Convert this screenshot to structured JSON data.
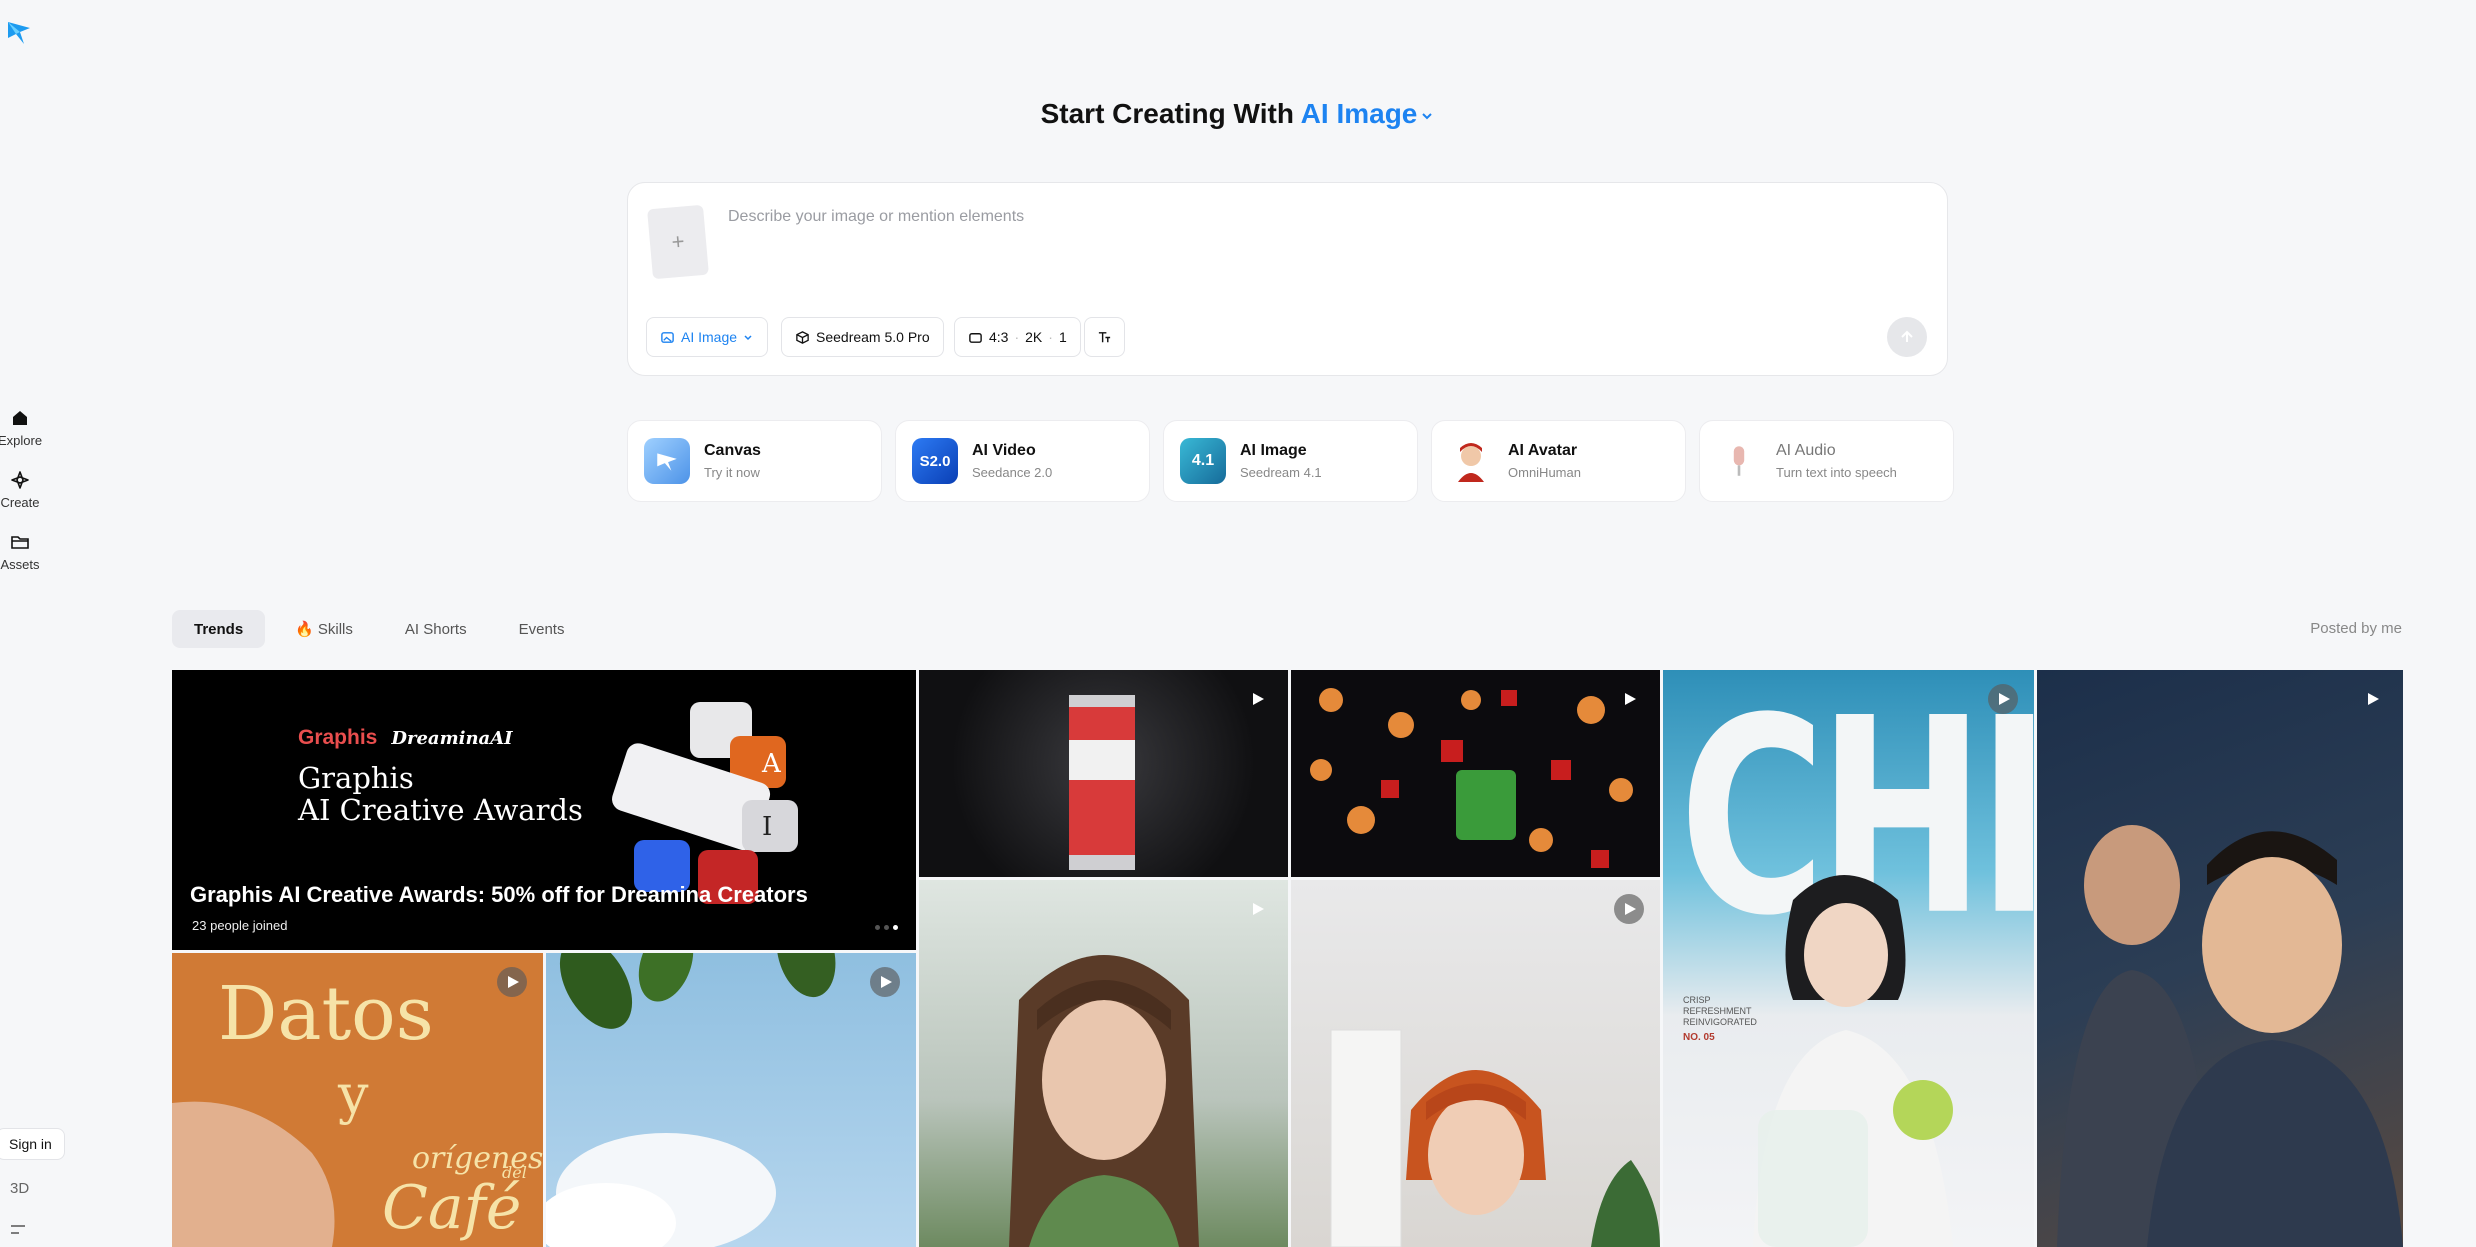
{
  "sidebar": {
    "items": [
      {
        "label": "Explore",
        "icon": "home-icon"
      },
      {
        "label": "Create",
        "icon": "sparkle-icon"
      },
      {
        "label": "Assets",
        "icon": "folder-icon"
      }
    ],
    "sign_in": "Sign in",
    "three_d": "3D"
  },
  "header": {
    "prefix": "Start Creating With",
    "mode": "AI Image"
  },
  "prompt": {
    "placeholder": "Describe your image or mention elements",
    "mode_chip": "AI Image",
    "model_chip": "Seedream 5.0 Pro",
    "ratio": "4:3",
    "resolution": "2K",
    "count": "1"
  },
  "features": [
    {
      "title": "Canvas",
      "subtitle": "Try it now"
    },
    {
      "title": "AI Video",
      "subtitle": "Seedance 2.0",
      "badge": "S2.0"
    },
    {
      "title": "AI Image",
      "subtitle": "Seedream 4.1",
      "badge": "4.1"
    },
    {
      "title": "AI Avatar",
      "subtitle": "OmniHuman"
    },
    {
      "title": "AI Audio",
      "subtitle": "Turn text into speech"
    }
  ],
  "tabs": {
    "items": [
      "Trends",
      "Skills",
      "AI Shorts",
      "Events"
    ],
    "posted_by_me": "Posted by me"
  },
  "gallery": {
    "hero": {
      "brand_left": "Graphis",
      "brand_right": "DreaminaAI",
      "headline_line1": "Graphis",
      "headline_line2": "AI Creative Awards",
      "title": "Graphis AI Creative Awards: 50% off for Dreamina Creators",
      "joined_count": "23",
      "joined_label": "people joined"
    },
    "datos": {
      "line1": "Datos",
      "line2": "y",
      "line3": "orígenes",
      "line4": "del",
      "line5": "Café"
    },
    "chill": {
      "word": "CHILL",
      "sub1": "CRISP",
      "sub2": "REFRESHMENT",
      "sub3": "REINVIGORATED",
      "issue": "NO. 05"
    }
  },
  "colors": {
    "accent": "#1d83f1",
    "background": "#f6f7f9"
  }
}
